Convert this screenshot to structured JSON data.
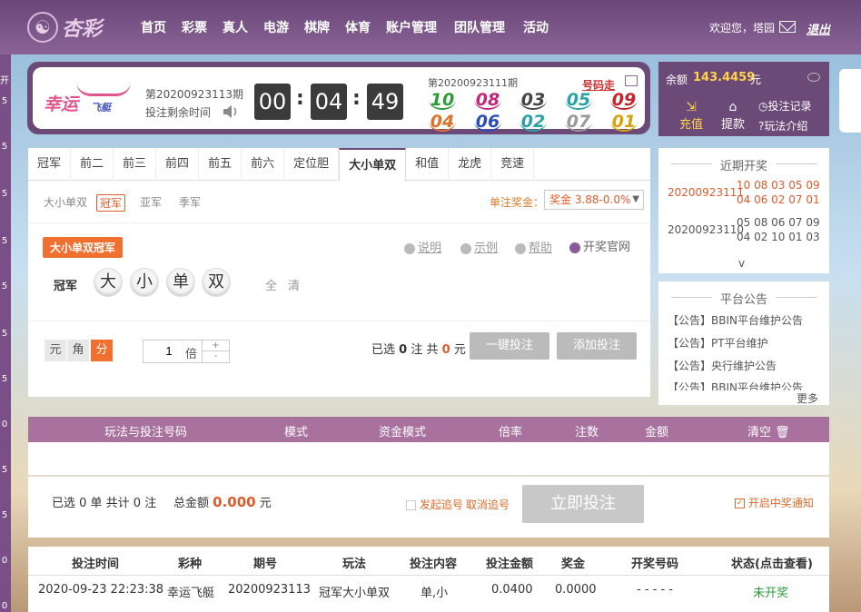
{
  "topnav": {
    "logo_text": "杏彩",
    "items": [
      "首页",
      "彩票",
      "真人",
      "电游",
      "棋牌",
      "体育",
      "账户管理",
      "团队管理",
      "活动"
    ],
    "welcome": "欢迎您，塔园",
    "logout": "退出"
  },
  "leftstrip": {
    "nums": [
      "开",
      "5",
      "5",
      "5",
      "5",
      "5",
      "5",
      "5",
      "0",
      "5",
      "5",
      "0",
      "0"
    ]
  },
  "game": {
    "logo_main": "幸运",
    "logo_sub": "飞艇",
    "current_issue": "第20200923113期",
    "countdown_label": "投注剩余时间",
    "countdown": [
      "00",
      "04",
      "49"
    ],
    "prev_issue": "第20200923111期",
    "leave_number": "号码走",
    "balls": [
      {
        "n": "10",
        "c": "#2e9b3a"
      },
      {
        "n": "08",
        "c": "#c2287a"
      },
      {
        "n": "03",
        "c": "#444"
      },
      {
        "n": "05",
        "c": "#2aa3a8"
      },
      {
        "n": "09",
        "c": "#c8222a"
      },
      {
        "n": "04",
        "c": "#e0702a"
      },
      {
        "n": "06",
        "c": "#2a4fb8"
      },
      {
        "n": "02",
        "c": "#2aa3a8"
      },
      {
        "n": "07",
        "c": "#999"
      },
      {
        "n": "01",
        "c": "#d8a20a"
      }
    ]
  },
  "balance": {
    "label": "余额",
    "value": "143.4459",
    "unit": "元",
    "recharge": "充值",
    "withdraw": "提款",
    "bet_record": "投注记录",
    "play_intro": "玩法介绍"
  },
  "tabs": [
    "冠军",
    "前二",
    "前三",
    "前四",
    "前五",
    "前六",
    "定位胆",
    "大小单双",
    "和值",
    "龙虎",
    "竞速"
  ],
  "active_tab": "大小单双",
  "subtabs": [
    "大小单双",
    "冠军",
    "亚军",
    "季军"
  ],
  "prize": {
    "label": "单注奖金：",
    "value": "奖金 3.88-0.0%"
  },
  "play_badge": "大小单双冠军",
  "hints": [
    "说明",
    "示例",
    "帮助"
  ],
  "official": "开奖官网",
  "position": {
    "label": "冠军",
    "options": [
      "大",
      "小",
      "单",
      "双"
    ],
    "quick": [
      "全",
      "清"
    ]
  },
  "units": [
    "元",
    "角",
    "分"
  ],
  "multiplier": {
    "value": "1",
    "unit": "倍",
    "up": "+",
    "down": "-"
  },
  "selection": {
    "prefix": "已选",
    "count": "0",
    "mid": "注  共",
    "amount": "0",
    "suffix": "元"
  },
  "buttons": {
    "onekey": "一键投注",
    "add": "添加投注",
    "bet_now": "立即投注"
  },
  "recent": {
    "title": "近期开奖",
    "rows": [
      {
        "issue": "20200923111",
        "nums": "10 08 03 05 09 04 06 02 07 01",
        "color": "#e05a2a"
      },
      {
        "issue": "20200923110",
        "nums": "05 08 06 07 09 04 02 10 01 03",
        "color": "#555"
      }
    ],
    "chevron": "v"
  },
  "notice": {
    "title": "平台公告",
    "items": [
      "【公告】BBIN平台维护公告",
      "【公告】PT平台维护",
      "【公告】央行维护公告",
      "【公告】BBIN平台维护公告"
    ],
    "more": "更多"
  },
  "cart": {
    "headers": [
      "玩法与投注号码",
      "模式",
      "资金模式",
      "倍率",
      "注数",
      "金额",
      "清空"
    ],
    "footer_left": "已选 0 单 共计 0 注",
    "total_label": "总金额",
    "total_value": "0.000",
    "total_unit": "元",
    "chase": "发起追号",
    "cancel_chase": "取消追号",
    "notify": "开启中奖通知"
  },
  "history": {
    "headers": [
      "投注时间",
      "彩种",
      "期号",
      "玩法",
      "投注内容",
      "投注金额",
      "奖金",
      "开奖号码",
      "状态(点击查看)"
    ],
    "row": [
      "2020-09-23 22:23:38",
      "幸运飞艇",
      "20200923113",
      "冠军大小单双",
      "单,小",
      "0.0400",
      "0.0000",
      "- - - - -",
      "未开奖"
    ]
  }
}
